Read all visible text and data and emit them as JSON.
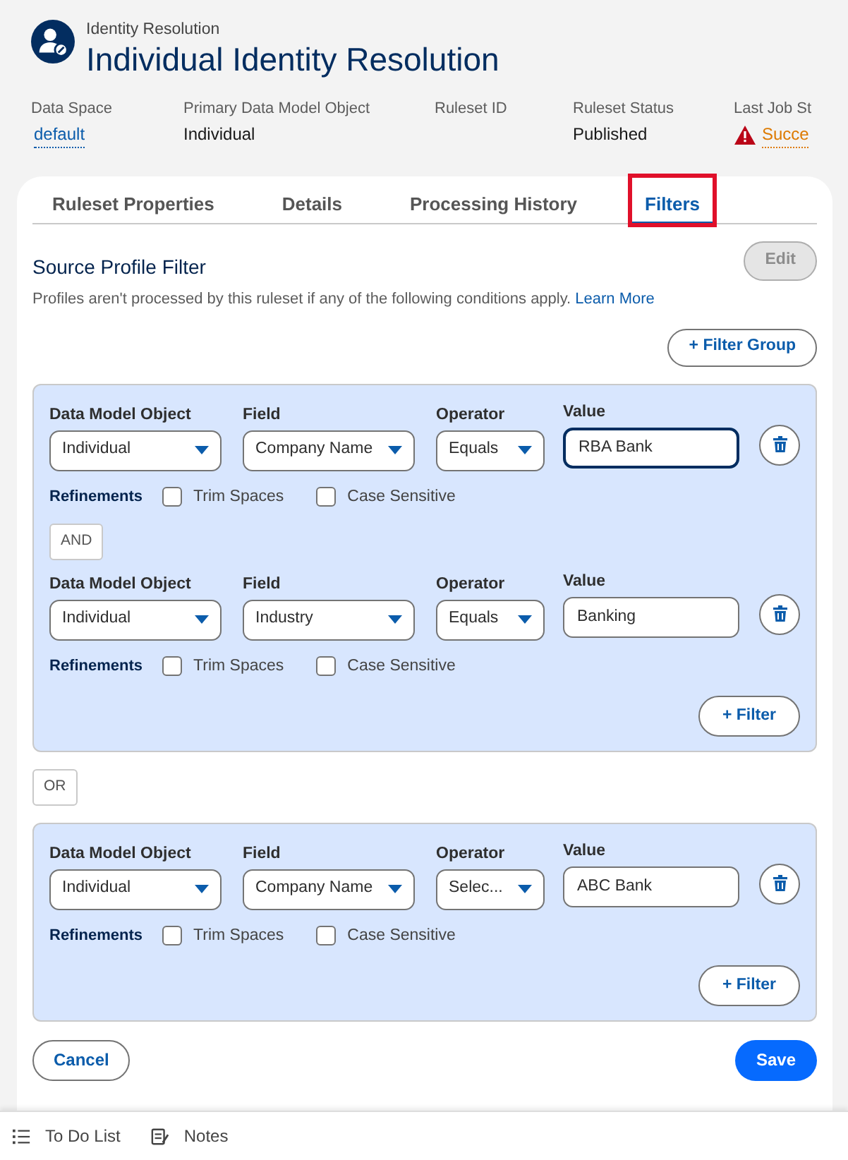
{
  "header": {
    "object_type": "Identity Resolution",
    "title": "Individual Identity Resolution"
  },
  "fields": [
    {
      "label": "Data Space",
      "value": "default",
      "kind": "link"
    },
    {
      "label": "Primary Data Model Object",
      "value": "Individual",
      "kind": "text"
    },
    {
      "label": "Ruleset ID"
    },
    {
      "label": "Ruleset Status",
      "value": "Published",
      "kind": "text"
    },
    {
      "label": "Last Job St",
      "value": "Succe",
      "kind": "warning"
    }
  ],
  "tabs": [
    {
      "label": "Ruleset Properties",
      "selected": false,
      "highlighted": false
    },
    {
      "label": "Details",
      "selected": false,
      "highlighted": false
    },
    {
      "label": "Processing History",
      "selected": false,
      "highlighted": false
    },
    {
      "label": "Filters",
      "selected": true,
      "highlighted": true
    }
  ],
  "section": {
    "title": "Source Profile Filter",
    "description": "Profiles aren't processed by this ruleset if any of the following conditions apply.",
    "link": "Learn More",
    "edit_button": {
      "label": "Edit",
      "disabled": true
    },
    "add_group_button": "+ Filter Group"
  },
  "groups": [
    {
      "conditions": [
        {
          "object_label": "Data Model Object",
          "object": "Individual",
          "field_label": "Field",
          "field": "Company Name",
          "operator_label": "Operator",
          "operator": "Equals",
          "value_label": "Value",
          "value": "RBA Bank",
          "focused": true,
          "refinements_label": "Refinements",
          "options": [
            {
              "label": "Trim Spaces",
              "checked": false
            },
            {
              "label": "Case Sensitive",
              "checked": false
            }
          ]
        },
        {
          "connector": "AND",
          "object_label": "Data Model Object",
          "object": "Individual",
          "field_label": "Field",
          "field": "Industry",
          "operator_label": "Operator",
          "operator": "Equals",
          "value_label": "Value",
          "value": "Banking",
          "focused": false,
          "refinements_label": "Refinements",
          "options": [
            {
              "label": "Trim Spaces",
              "checked": false
            },
            {
              "label": "Case Sensitive",
              "checked": false
            }
          ]
        }
      ],
      "add_filter_button": "+ Filter"
    },
    {
      "connector": "OR",
      "conditions": [
        {
          "object_label": "Data Model Object",
          "object": "Individual",
          "field_label": "Field",
          "field": "Company Name",
          "operator_label": "Operator",
          "operator": "Selec...",
          "value_label": "Value",
          "value": "ABC Bank",
          "focused": false,
          "refinements_label": "Refinements",
          "options": [
            {
              "label": "Trim Spaces",
              "checked": false
            },
            {
              "label": "Case Sensitive",
              "checked": false
            }
          ]
        }
      ],
      "add_filter_button": "+ Filter"
    }
  ],
  "actions": {
    "cancel": "Cancel",
    "save": "Save"
  },
  "utility_bar": [
    {
      "label": "To Do List",
      "kind": "list"
    },
    {
      "label": "Notes",
      "kind": "notes"
    }
  ]
}
